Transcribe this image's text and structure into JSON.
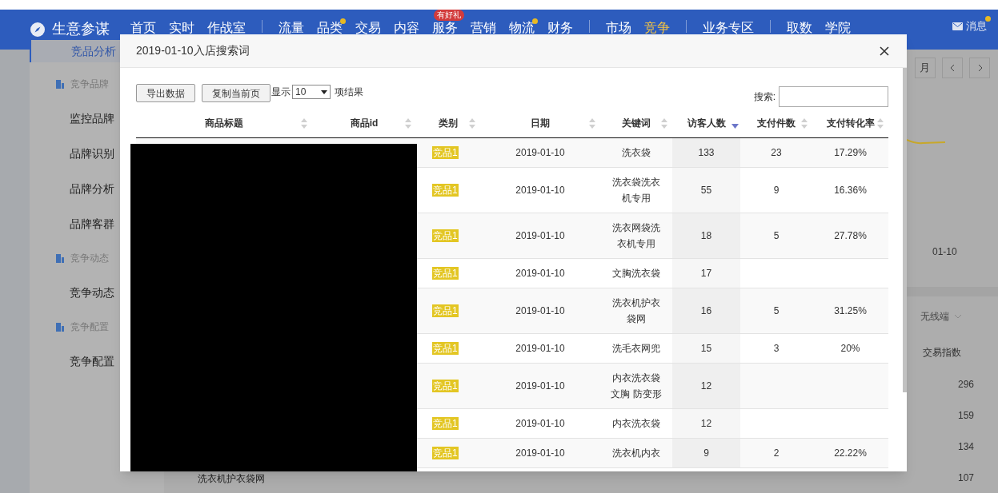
{
  "nav": {
    "brand": "生意参谋",
    "groups": [
      [
        {
          "label": "首页",
          "dot": false,
          "selected": false
        },
        {
          "label": "实时",
          "dot": false,
          "selected": false
        },
        {
          "label": "作战室",
          "dot": false,
          "selected": false
        }
      ],
      [
        {
          "label": "流量",
          "dot": false,
          "selected": false
        },
        {
          "label": "品类",
          "dot": true,
          "selected": false
        },
        {
          "label": "交易",
          "dot": false,
          "selected": false
        },
        {
          "label": "内容",
          "dot": false,
          "selected": false
        },
        {
          "label": "服务",
          "dot": false,
          "badge": "有好礼",
          "selected": false
        },
        {
          "label": "营销",
          "dot": false,
          "selected": false
        },
        {
          "label": "物流",
          "dot": true,
          "selected": false
        },
        {
          "label": "财务",
          "dot": false,
          "selected": false
        }
      ],
      [
        {
          "label": "市场",
          "dot": false,
          "selected": false
        },
        {
          "label": "竞争",
          "dot": false,
          "selected": true
        }
      ],
      [
        {
          "label": "业务专区",
          "dot": false,
          "selected": false
        }
      ],
      [
        {
          "label": "取数",
          "dot": false,
          "selected": false
        },
        {
          "label": "学院",
          "dot": false,
          "selected": false
        }
      ]
    ],
    "messages": {
      "label": "消息",
      "dot": true
    }
  },
  "sidebar": [
    {
      "kind": "item",
      "label": "竞品分析",
      "selected": true
    },
    {
      "kind": "group",
      "label": "竞争品牌"
    },
    {
      "kind": "item",
      "label": "监控品牌",
      "selected": false
    },
    {
      "kind": "item",
      "label": "品牌识别",
      "selected": false
    },
    {
      "kind": "item",
      "label": "品牌分析",
      "selected": false
    },
    {
      "kind": "item",
      "label": "品牌客群",
      "selected": false
    },
    {
      "kind": "group",
      "label": "竞争动态"
    },
    {
      "kind": "item",
      "label": "竞争动态",
      "selected": false
    },
    {
      "kind": "group",
      "label": "竞争配置"
    },
    {
      "kind": "item",
      "label": "竞争配置",
      "selected": false
    }
  ],
  "background": {
    "period_button": "月",
    "chart_x_label": "01-10",
    "device_select": "无线端",
    "column_heading": "交易指数",
    "values": [
      "296",
      "159",
      "134",
      "107"
    ],
    "row_text": "洗衣机护衣袋网"
  },
  "modal": {
    "title": "2019-01-10入店搜索词",
    "buttons": [
      "导出数据",
      "复制当前页"
    ],
    "show_label": "显示",
    "page_size": "10",
    "suffix": "项结果",
    "search_label": "搜索:",
    "columns": [
      {
        "label": "商品标题",
        "sorted_desc": false
      },
      {
        "label": "商品id",
        "sorted_desc": false
      },
      {
        "label": "类别",
        "sorted_desc": false
      },
      {
        "label": "日期",
        "sorted_desc": false
      },
      {
        "label": "关键词",
        "sorted_desc": false
      },
      {
        "label": "访客人数",
        "sorted_desc": true
      },
      {
        "label": "支付件数",
        "sorted_desc": false
      },
      {
        "label": "支付转化率",
        "sorted_desc": false
      }
    ],
    "rows": [
      {
        "category": "竞品1",
        "date": "2019-01-10",
        "keyword": "洗衣袋",
        "visitors": "133",
        "payments": "23",
        "conversion": "17.29%"
      },
      {
        "category": "竞品1",
        "date": "2019-01-10",
        "keyword": "洗衣袋洗衣机专用",
        "visitors": "55",
        "payments": "9",
        "conversion": "16.36%"
      },
      {
        "category": "竞品1",
        "date": "2019-01-10",
        "keyword": "洗衣网袋洗衣机专用",
        "visitors": "18",
        "payments": "5",
        "conversion": "27.78%"
      },
      {
        "category": "竞品1",
        "date": "2019-01-10",
        "keyword": "文胸洗衣袋",
        "visitors": "17"
      },
      {
        "category": "竞品1",
        "date": "2019-01-10",
        "keyword": "洗衣机护衣袋网",
        "visitors": "16",
        "payments": "5",
        "conversion": "31.25%"
      },
      {
        "category": "竞品1",
        "date": "2019-01-10",
        "keyword": "洗毛衣网兜",
        "visitors": "15",
        "payments": "3",
        "conversion": "20%"
      },
      {
        "category": "竞品1",
        "date": "2019-01-10",
        "keyword": "内衣洗衣袋文胸 防变形",
        "visitors": "12"
      },
      {
        "category": "竞品1",
        "date": "2019-01-10",
        "keyword": "内衣洗衣袋",
        "visitors": "12"
      },
      {
        "category": "竞品1",
        "date": "2019-01-10",
        "keyword": "洗衣机内衣",
        "visitors": "9",
        "payments": "2",
        "conversion": "22.22%"
      }
    ]
  }
}
